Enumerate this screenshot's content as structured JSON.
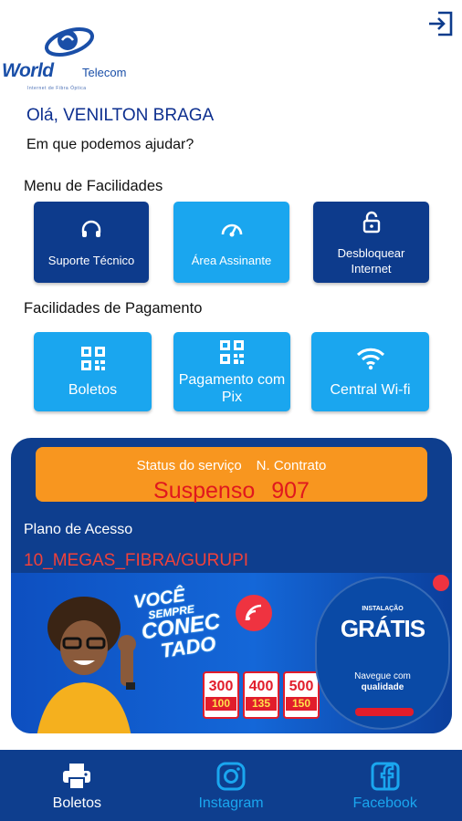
{
  "header": {
    "logo_brand": "World",
    "logo_brand_suffix": "Telecom",
    "logo_tagline": "Internet de Fibra Óptica",
    "logout_icon": "logout-icon"
  },
  "greeting": {
    "hello": "Olá, VENILTON BRAGA",
    "help": "Em que podemos ajudar?"
  },
  "facilities": {
    "title": "Menu de Facilidades",
    "items": [
      {
        "label": "Suporte Técnico",
        "icon": "headset-icon"
      },
      {
        "label": "Área Assinante",
        "icon": "gauge-icon"
      },
      {
        "label": "Desbloquear Internet",
        "icon": "unlock-icon"
      }
    ]
  },
  "payment": {
    "title": "Facilidades de Pagamento",
    "items": [
      {
        "label": "Boletos",
        "icon": "qr-code-icon"
      },
      {
        "label": "Pagamento com Pix",
        "icon": "qr-code-icon"
      },
      {
        "label": "Central Wi-fi",
        "icon": "wifi-icon"
      }
    ]
  },
  "service": {
    "status_label": "Status do serviço",
    "contract_label": "N. Contrato",
    "status_value": "Suspenso",
    "contract_value": "907",
    "plan_label": "Plano de Acesso",
    "plan_value": "10_MEGAS_FIBRA/GURUPI"
  },
  "banner": {
    "slogan_lines": [
      "VOCÊ",
      "SEMPRE",
      "CONEC",
      "TADO"
    ],
    "offers": [
      {
        "speed": "300",
        "price": "100"
      },
      {
        "speed": "400",
        "price": "135"
      },
      {
        "speed": "500",
        "price": "150"
      }
    ],
    "circle_brand": "INSTALAÇÃO",
    "circle_free": "GRÁTIS",
    "circle_line1": "Navegue com",
    "circle_line2": "qualidade"
  },
  "bottom_nav": [
    {
      "label": "Boletos",
      "icon": "printer-icon",
      "active": true
    },
    {
      "label": "Instagram",
      "icon": "instagram-icon",
      "active": false
    },
    {
      "label": "Facebook",
      "icon": "facebook-icon",
      "active": false
    }
  ],
  "colors": {
    "primary_dark": "#0e3e8e",
    "primary_light": "#1aa6ef",
    "status_orange": "#f8961f",
    "alert_red": "#e0181e"
  }
}
